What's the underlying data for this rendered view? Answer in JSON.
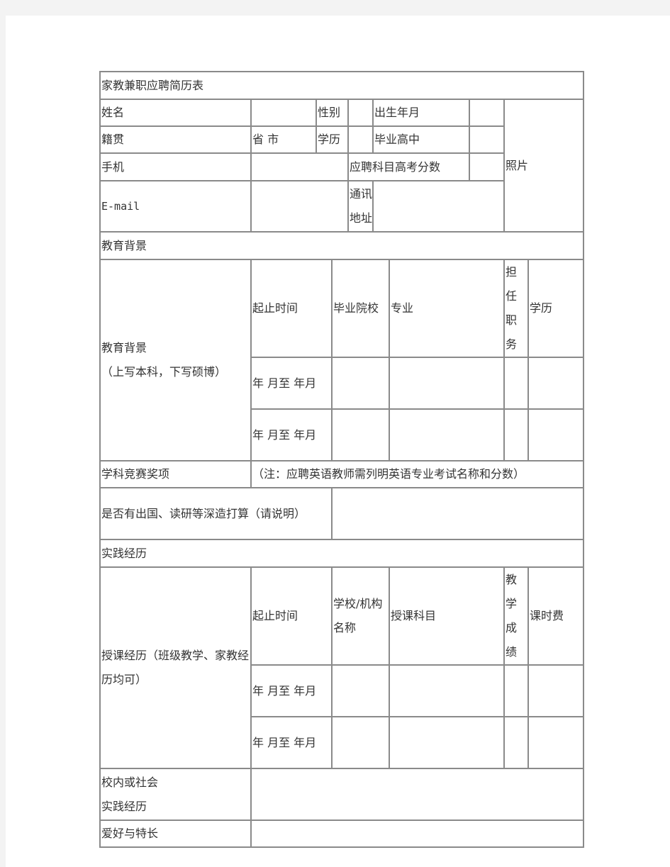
{
  "title": "家教兼职应聘简历表",
  "personal": {
    "name_label": "姓名",
    "gender_label": "性别",
    "birth_label": "出生年月",
    "origin_label": "籍贯",
    "origin_value": "省 市",
    "degree_label": "学历",
    "highschool_label": "毕业高中",
    "photo_label": "照片",
    "phone_label": "手机",
    "gaokao_label": "应聘科目高考分数",
    "email_label": "E-mail",
    "address_label": "通讯地址"
  },
  "education": {
    "section_title": "教育背景",
    "row_label": "教育背景",
    "row_note": "（上写本科，下写硕博）",
    "headers": [
      "起止时间",
      "毕业院校",
      "专业",
      "担任职务",
      "学历"
    ],
    "period_text": "年 月至 年月"
  },
  "awards": {
    "label": "学科竞赛奖项",
    "note": "（注：应聘英语教师需列明英语专业考试名称和分数）"
  },
  "further_study": {
    "label": "是否有出国、读研等深造打算（请说明）"
  },
  "practice": {
    "section_title": "实践经历",
    "teaching_label": "授课经历（班级教学、家教经历均可）",
    "headers": [
      "起止时间",
      "学校/机构名称",
      "授课科目",
      "教学成绩",
      "课时费"
    ],
    "period_text": "年 月至 年月",
    "social_label_1": "校内或社会",
    "social_label_2": "实践经历",
    "hobbies_label": "爱好与特长"
  }
}
